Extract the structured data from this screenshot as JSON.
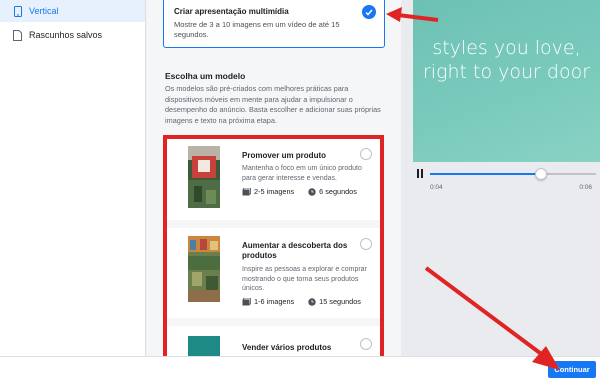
{
  "sidebar": {
    "items": [
      {
        "label": "Vertical",
        "icon": "phone-icon",
        "active": true
      },
      {
        "label": "Rascunhos salvos",
        "icon": "document-icon",
        "active": false
      }
    ]
  },
  "format_card": {
    "title": "Criar apresentação multimídia",
    "description": "Mostre de 3 a 10 imagens em um vídeo de até 15 segundos.",
    "selected": true
  },
  "models": {
    "title": "Escolha um modelo",
    "description": "Os modelos são pré-criados com melhores práticas para dispositivos móveis em mente para ajudar a impulsionar o desempenho do anúncio. Basta escolher e adicionar suas próprias imagens e texto na próxima etapa.",
    "templates": [
      {
        "name": "Promover um produto",
        "description": "Mantenha o foco em um único produto para gerar interesse e vendas.",
        "images": "2-5 imagens",
        "duration": "6 segundos"
      },
      {
        "name": "Aumentar a descoberta dos produtos",
        "description": "Inspire as pessoas a explorar e comprar mostrando o que torna seus produtos únicos.",
        "images": "1-6 imagens",
        "duration": "15 segundos"
      },
      {
        "name": "Vender vários produtos"
      }
    ]
  },
  "preview": {
    "text": "styles you love, right to your door",
    "progress": 0.67,
    "time_current": "0:04",
    "time_total": "0:06"
  },
  "footer": {
    "continue_label": "Continuar"
  },
  "colors": {
    "accent": "#1877f2",
    "annotation_red": "#e02424",
    "preview_bg": "#7bcbbd"
  }
}
